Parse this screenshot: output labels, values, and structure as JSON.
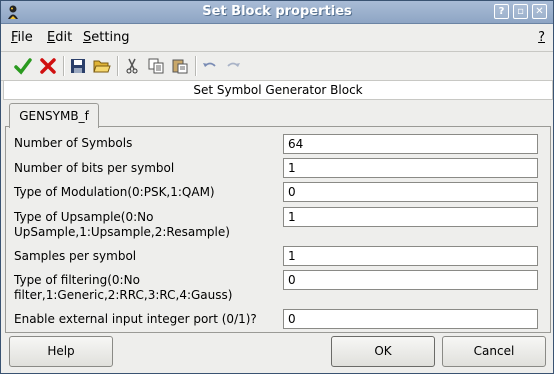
{
  "window": {
    "title": "Set Block properties"
  },
  "menubar": {
    "items": [
      {
        "label": "File",
        "underline": "F",
        "rest": "ile"
      },
      {
        "label": "Edit",
        "underline": "E",
        "rest": "dit"
      },
      {
        "label": "Setting",
        "underline": "S",
        "rest": "etting"
      }
    ],
    "help": "?"
  },
  "toolbar": {
    "icons": [
      "check-icon",
      "cross-icon",
      "save-icon",
      "open-folder-icon",
      "cut-icon",
      "copy-icon",
      "paste-icon",
      "undo-icon",
      "redo-icon"
    ]
  },
  "banner": {
    "text": "Set Symbol Generator Block"
  },
  "tab": {
    "label": "GENSYMB_f"
  },
  "fields": [
    {
      "label": "Number of Symbols",
      "value": "64"
    },
    {
      "label": "Number of bits per symbol",
      "value": "1"
    },
    {
      "label": "Type of Modulation(0:PSK,1:QAM)",
      "value": "0"
    },
    {
      "label": "Type of Upsample(0:No",
      "label2": "UpSample,1:Upsample,2:Resample)",
      "value": "1"
    },
    {
      "label": "Samples per symbol",
      "value": "1"
    },
    {
      "label": "Type of filtering(0:No",
      "label2": "filter,1:Generic,2:RRC,3:RC,4:Gauss)",
      "value": "0"
    },
    {
      "label": "Enable external input integer port (0/1)?",
      "value": "0"
    }
  ],
  "buttons": {
    "help": "Help",
    "ok": "OK",
    "cancel": "Cancel"
  },
  "colors": {
    "titlebar": "#9db2cf",
    "check": "#2a9a1f",
    "cross": "#d01010"
  }
}
